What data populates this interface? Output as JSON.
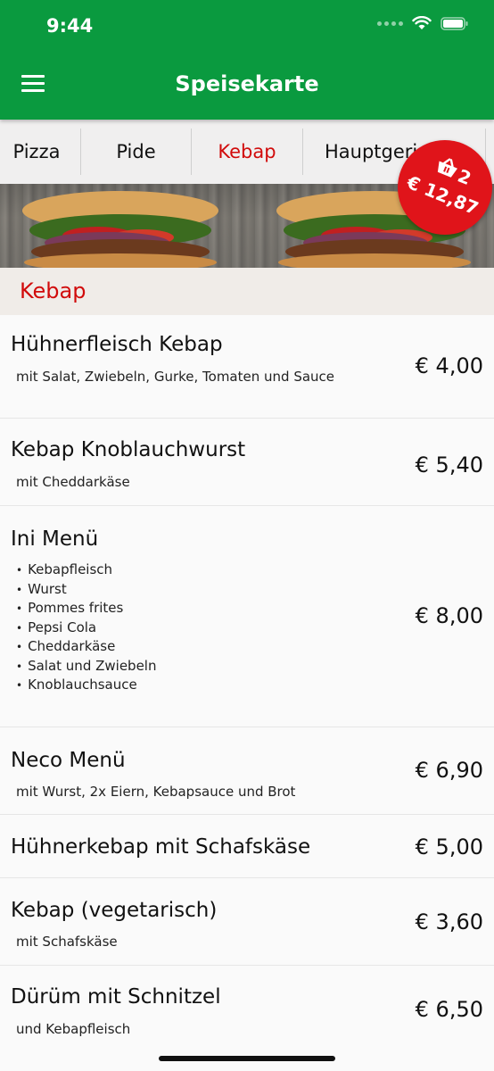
{
  "status_bar": {
    "time": "9:44"
  },
  "header": {
    "title": "Speisekarte",
    "menu_icon": "hamburger-icon"
  },
  "tabs": [
    {
      "label": "Pizza",
      "active": false
    },
    {
      "label": "Pide",
      "active": false
    },
    {
      "label": "Kebap",
      "active": true
    },
    {
      "label": "Hauptgerichte",
      "active": false
    }
  ],
  "cart": {
    "count": "2",
    "total": "€ 12,87",
    "icon": "basket-icon"
  },
  "section": {
    "title": "Kebap"
  },
  "items": [
    {
      "name": "Hühnerfleisch Kebap",
      "description": "mit Salat, Zwiebeln, Gurke, Tomaten und Sauce",
      "price": "€ 4,00"
    },
    {
      "name": "Kebap Knoblauchwurst",
      "description": "mit Cheddarkäse",
      "price": "€ 5,40"
    },
    {
      "name": "Ini Menü",
      "bullets": [
        "Kebapfleisch",
        "Wurst",
        "Pommes frites",
        "Pepsi Cola",
        "Cheddarkäse",
        "Salat und Zwiebeln",
        "Knoblauchsauce"
      ],
      "price": "€ 8,00"
    },
    {
      "name": "Neco Menü",
      "description": "mit Wurst, 2x Eiern, Kebapsauce und Brot",
      "price": "€ 6,90"
    },
    {
      "name": "Hühnerkebap mit Schafskäse",
      "price": "€ 5,00"
    },
    {
      "name": "Kebap (vegetarisch)",
      "description": "mit Schafskäse",
      "price": "€ 3,60"
    },
    {
      "name": "Dürüm mit Schnitzel",
      "description": "und Kebapfleisch",
      "price": "€ 6,50"
    }
  ],
  "colors": {
    "brand_green": "#0a9a3f",
    "accent_red": "#d10b0b",
    "cart_red": "#e0141a"
  }
}
